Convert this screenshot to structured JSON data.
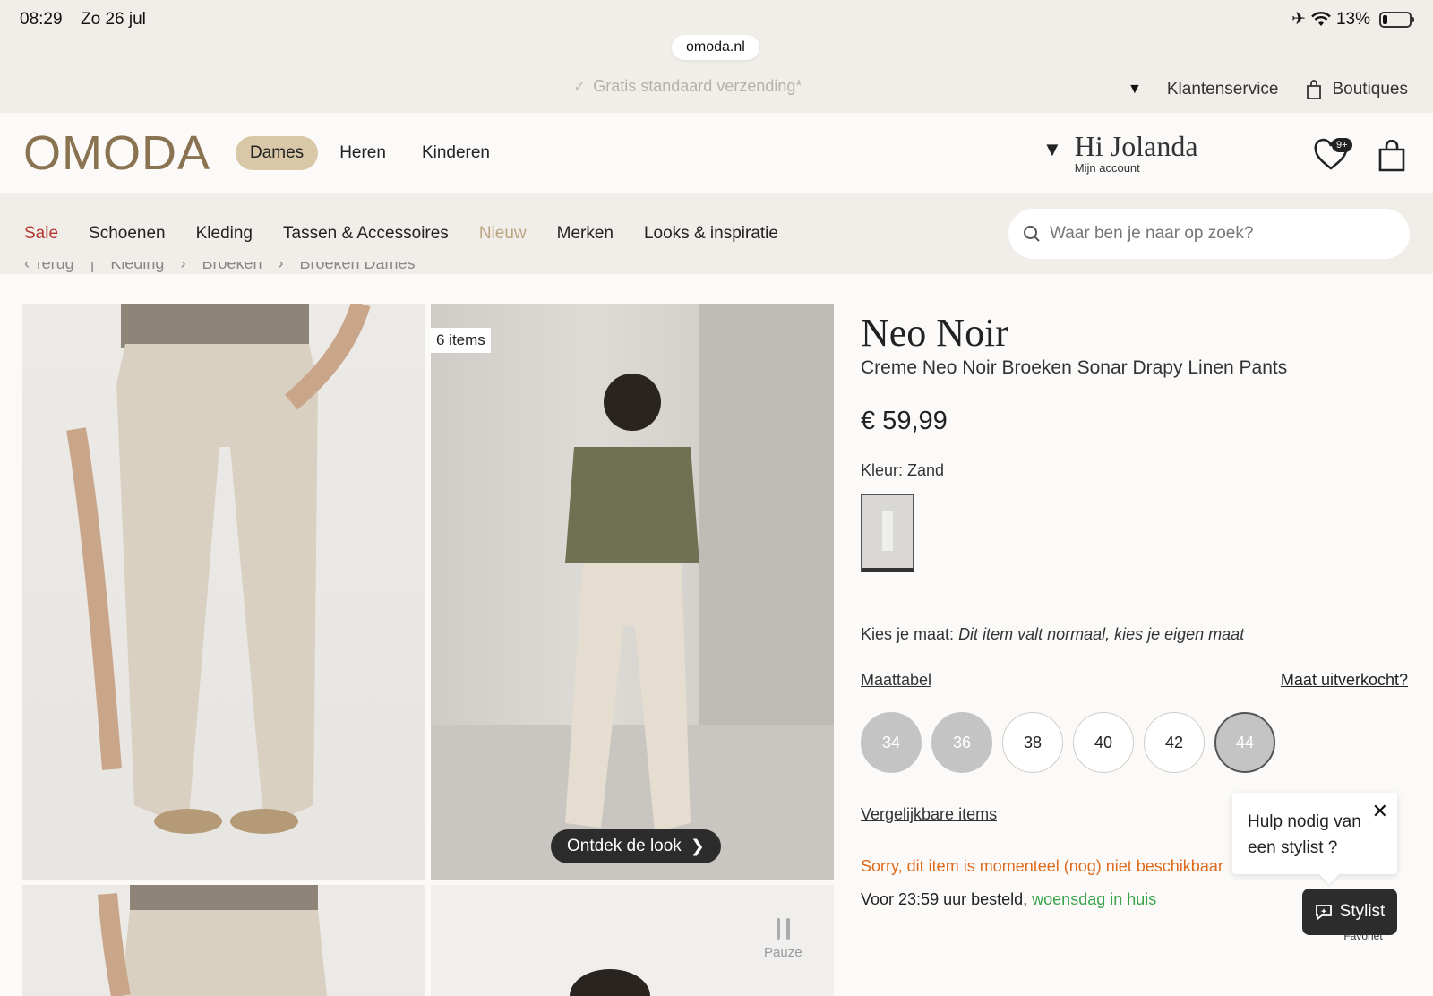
{
  "status_bar": {
    "time": "08:29",
    "date": "Zo 26 jul",
    "battery": "13%"
  },
  "browser": {
    "url": "omoda.nl"
  },
  "topbar": {
    "shipping": "Gratis standaard verzending*",
    "customer_service": "Klantenservice",
    "boutiques": "Boutiques"
  },
  "header": {
    "logo": "OMODA",
    "genders": [
      "Dames",
      "Heren",
      "Kinderen"
    ],
    "greeting": "Hi Jolanda",
    "account_sub": "Mijn account",
    "wishlist_badge": "9+"
  },
  "nav": {
    "items": [
      "Sale",
      "Schoenen",
      "Kleding",
      "Tassen & Accessoires",
      "Nieuw",
      "Merken",
      "Looks & inspiratie"
    ],
    "search_placeholder": "Waar ben je naar op zoek?"
  },
  "breadcrumb": [
    "‹ Terug",
    "|",
    "Kleding",
    "›",
    "Broeken",
    "›",
    "Broeken Dames"
  ],
  "gallery": {
    "items_tag": "6 items",
    "look_button": "Ontdek de look",
    "pause_label": "Pauze"
  },
  "product": {
    "brand": "Neo Noir",
    "name": "Creme Neo Noir Broeken Sonar Drapy Linen Pants",
    "price": "€ 59,99",
    "color_label": "Kleur: Zand",
    "size_label": "Kies je maat:",
    "size_hint": "Dit item valt normaal, kies je eigen maat",
    "size_table": "Maattabel",
    "sold_out_link": "Maat uitverkocht?",
    "sizes": [
      "34",
      "36",
      "38",
      "40",
      "42",
      "44"
    ],
    "compare": "Vergelijkbare items",
    "unavailable": "Sorry, dit item is momenteel (nog) niet beschikbaar",
    "delivery_prefix": "Voor 23:59 uur besteld,",
    "delivery_day": "woensdag in huis"
  },
  "stylist": {
    "popup_text": "Hulp nodig van een stylist ?",
    "button": "Stylist",
    "favorite": "Favoriet"
  }
}
